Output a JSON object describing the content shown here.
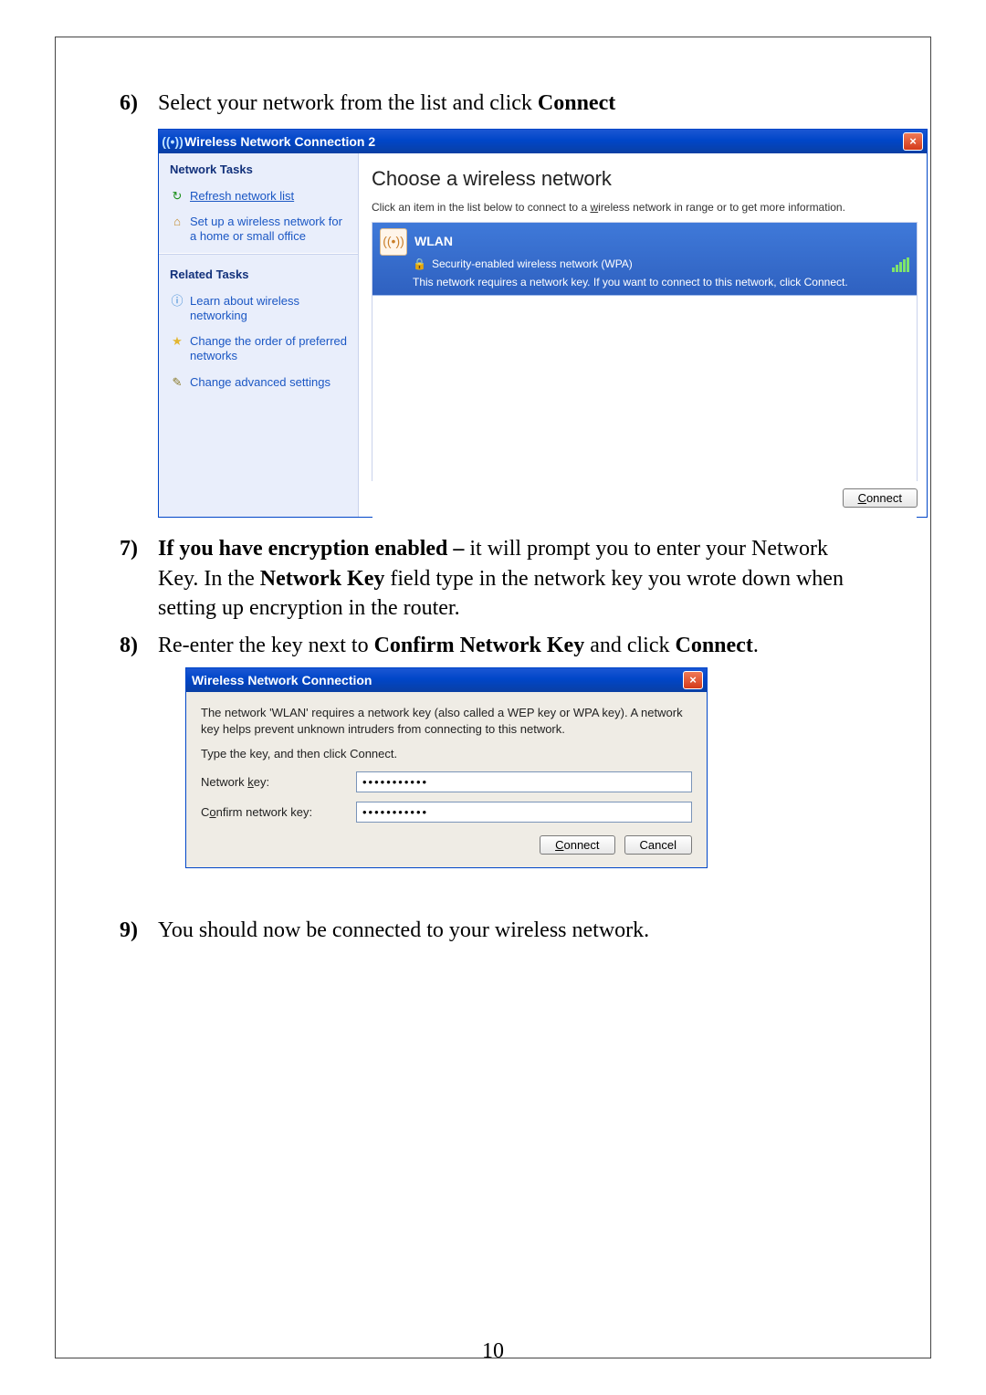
{
  "step6": {
    "num": "6)",
    "text": "Select your network from the list and click ",
    "bold": "Connect"
  },
  "win1": {
    "title": "Wireless Network Connection 2",
    "sidebar": {
      "sec1_title": "Network Tasks",
      "links1": [
        {
          "icon": "↻",
          "label": "Refresh network list",
          "underline": true
        },
        {
          "icon": "⌂",
          "label": "Set up a wireless network for a home or small office",
          "underline": false
        }
      ],
      "sec2_title": "Related Tasks",
      "links2": [
        {
          "icon": "ⓘ",
          "label": "Learn about wireless networking"
        },
        {
          "icon": "★",
          "label": "Change the order of preferred networks"
        },
        {
          "icon": "✎",
          "label": "Change advanced settings"
        }
      ]
    },
    "main_title": "Choose a wireless network",
    "main_sub_a": "Click an item in the list below to connect to a ",
    "main_sub_u": "w",
    "main_sub_b": "ireless network in range or to get more information.",
    "network": {
      "name": "WLAN",
      "security": "Security-enabled wireless network (WPA)",
      "msg": "This network requires a network key. If you want to connect to this network, click Connect."
    },
    "connect_btn": "onnect",
    "connect_u": "C"
  },
  "step7": {
    "num": "7)",
    "b1": "If you have encryption enabled – ",
    "t1": "it will prompt you to enter your Network Key. In the ",
    "b2": "Network Key",
    "t2": " field type in the network key you wrote down when setting up encryption in the router."
  },
  "step8": {
    "num": "8)",
    "t1": "Re-enter the key next to ",
    "b1": "Confirm Network Key",
    "t2": " and click ",
    "b2": "Connect",
    "t3": "."
  },
  "dlg": {
    "title": "Wireless Network Connection",
    "msg": "The network 'WLAN' requires a network key (also called a WEP key or WPA key). A network key helps prevent unknown intruders from connecting to this network.",
    "msg2": "Type the key, and then click Connect.",
    "f1_label_pre": "Network ",
    "f1_u": "k",
    "f1_label_post": "ey:",
    "f2_pre": "C",
    "f2_u": "o",
    "f2_post": "nfirm network key:",
    "value": "•••••••••••",
    "btn_connect_u": "C",
    "btn_connect": "onnect",
    "btn_cancel": "Cancel"
  },
  "step9": {
    "num": "9)",
    "text": "You should now be connected to your wireless network."
  },
  "pagenum": "10"
}
